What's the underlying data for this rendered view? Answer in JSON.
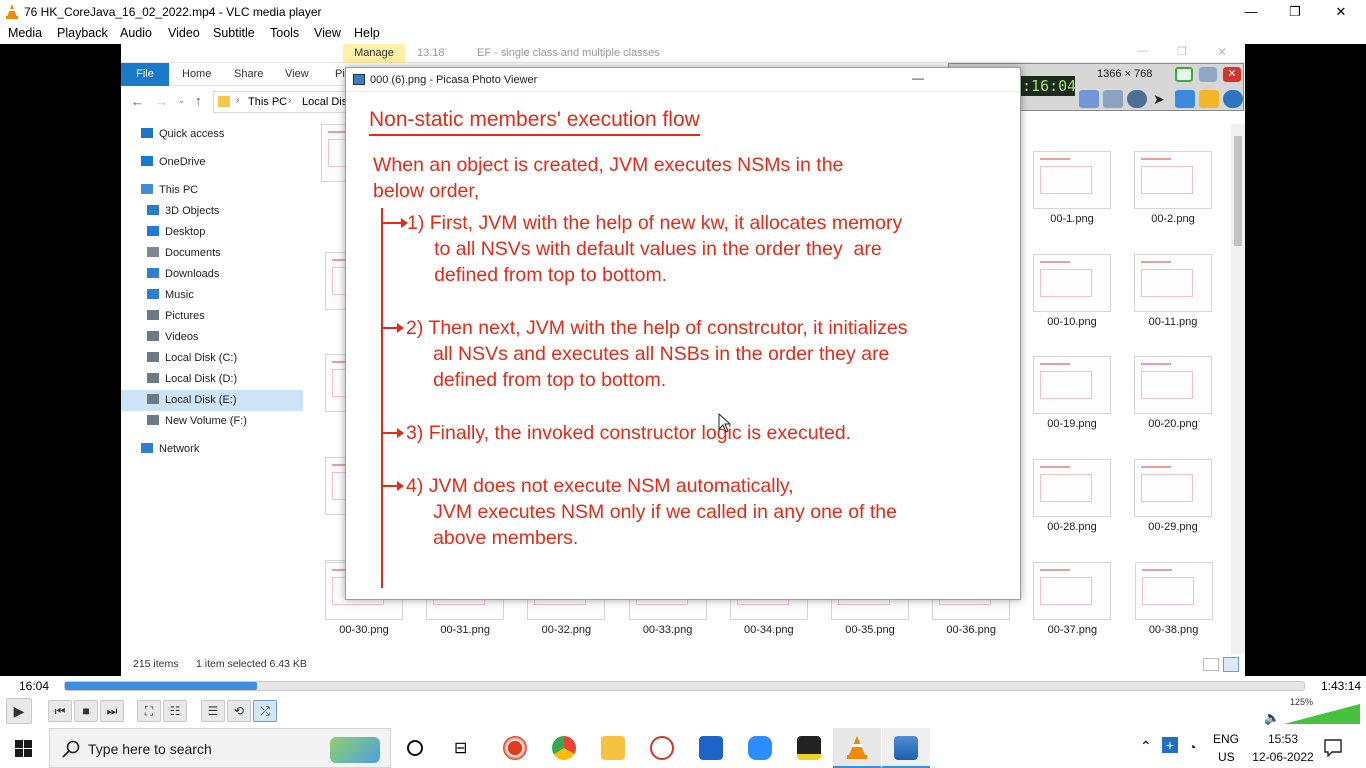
{
  "window": {
    "title": "76 HK_CoreJava_16_02_2022.mp4 - VLC media player",
    "minimize": "—",
    "restore": "❐",
    "close": "✕"
  },
  "menu": [
    "Media",
    "Playback",
    "Audio",
    "Video",
    "Subtitle",
    "Tools",
    "View",
    "Help"
  ],
  "explorer": {
    "manage_tab": "Manage",
    "path_hint": "13.18",
    "window_title": "EF - single class and multiple classes",
    "ribbon_tabs": [
      "File",
      "Home",
      "Share",
      "View",
      "Pic"
    ],
    "breadcrumb": [
      "This PC",
      "Local Dis"
    ],
    "nav": [
      {
        "label": "Quick access",
        "icon": "star-icon",
        "color": "#1e73c8"
      },
      {
        "label": "OneDrive",
        "icon": "cloud-icon",
        "color": "#1479d4"
      },
      {
        "label": "This PC",
        "icon": "computer-icon",
        "color": "#3f8fd7"
      },
      {
        "label": "3D Objects",
        "icon": "cube-icon",
        "color": "#2a7bc4"
      },
      {
        "label": "Desktop",
        "icon": "desktop-icon",
        "color": "#1e7ad6"
      },
      {
        "label": "Documents",
        "icon": "document-icon",
        "color": "#7c8a96"
      },
      {
        "label": "Downloads",
        "icon": "download-icon",
        "color": "#2c7fd1"
      },
      {
        "label": "Music",
        "icon": "music-icon",
        "color": "#2c7fd1"
      },
      {
        "label": "Pictures",
        "icon": "pictures-icon",
        "color": "#6c7a86"
      },
      {
        "label": "Videos",
        "icon": "videos-icon",
        "color": "#6c7a86"
      },
      {
        "label": "Local Disk (C:)",
        "icon": "drive-icon",
        "color": "#6c7a86"
      },
      {
        "label": "Local Disk (D:)",
        "icon": "drive-icon",
        "color": "#6c7a86"
      },
      {
        "label": "Local Disk (E:)",
        "icon": "drive-icon",
        "color": "#6c7a86",
        "selected": true
      },
      {
        "label": "New Volume (F:)",
        "icon": "drive-icon",
        "color": "#6c7a86"
      },
      {
        "label": "Network",
        "icon": "network-icon",
        "color": "#2c7fd1"
      }
    ],
    "thumb_labels_right": [
      [
        "00-1.png",
        "00-2.png"
      ],
      [
        "00-10.png",
        "00-11.png"
      ],
      [
        "00-19.png",
        "00-20.png"
      ],
      [
        "00-28.png",
        "00-29.png"
      ]
    ],
    "bottom_row_labels": [
      "00-30.png",
      "00-31.png",
      "00-32.png",
      "00-33.png",
      "00-34.png",
      "00-35.png",
      "00-36.png",
      "00-37.png",
      "00-38.png"
    ],
    "status_items": "215 items",
    "status_selected": "1 item selected  6.43 KB"
  },
  "picasa": {
    "title": "000 (6).png - Picasa Photo Viewer",
    "minimize": "—",
    "slide_title": "Non-static members' execution flow",
    "intro": "When an object is created, JVM executes NSMs in the\nbelow order,",
    "steps": [
      "1) First, JVM with the help of new kw, it allocates memory\n     to all NSVs with default values in the order they  are\n     defined from top to bottom.",
      "2) Then next, JVM with the help of constrcutor, it initializes\n     all NSVs and executes all NSBs in the order they are\n     defined from top to bottom.",
      "3) Finally, the invoked constructor logic is executed.",
      "4) JVM does not execute NSM automatically,\n     JVM executes NSM only if we called in any one of the\n     above members."
    ]
  },
  "recorder": {
    "time": "0:16:04",
    "resolution": "1366 × 768",
    "stop_color": "#e21c1c"
  },
  "player": {
    "current_time": "16:04",
    "total_time": "1:43:14",
    "progress_fraction": 0.155,
    "volume": "125%"
  },
  "taskbar": {
    "search_placeholder": "Type here to search",
    "lang_top": "ENG",
    "lang_bottom": "US",
    "time": "15:53",
    "date": "12-06-2022"
  }
}
